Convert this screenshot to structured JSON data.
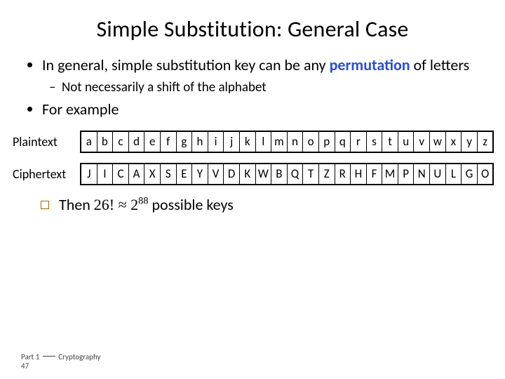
{
  "title": "Simple Substitution: General Case",
  "bullet1_a": "In general, simple substitution key can be any ",
  "bullet1_perm": "permutation",
  "bullet1_b": " of letters",
  "sub1": "Not necessarily a shift of the alphabet",
  "bullet2": "For example",
  "labels": {
    "plaintext": "Plaintext",
    "ciphertext": "Ciphertext"
  },
  "plain": [
    "a",
    "b",
    "c",
    "d",
    "e",
    "f",
    "g",
    "h",
    "i",
    "j",
    "k",
    "l",
    "m",
    "n",
    "o",
    "p",
    "q",
    "r",
    "s",
    "t",
    "u",
    "v",
    "w",
    "x",
    "y",
    "z"
  ],
  "cipher": [
    "J",
    "I",
    "C",
    "A",
    "X",
    "S",
    "E",
    "Y",
    "V",
    "D",
    "K",
    "W",
    "B",
    "Q",
    "T",
    "Z",
    "R",
    "H",
    "F",
    "M",
    "P",
    "N",
    "U",
    "L",
    "G",
    "O"
  ],
  "conclusion": {
    "prefix": "Then ",
    "fact": "26!",
    "approx": " ≈ ",
    "base": "2",
    "exp": "88",
    "suffix": " possible keys"
  },
  "footer": {
    "part": "Part 1 ",
    "section": " Cryptography",
    "page": "47"
  }
}
